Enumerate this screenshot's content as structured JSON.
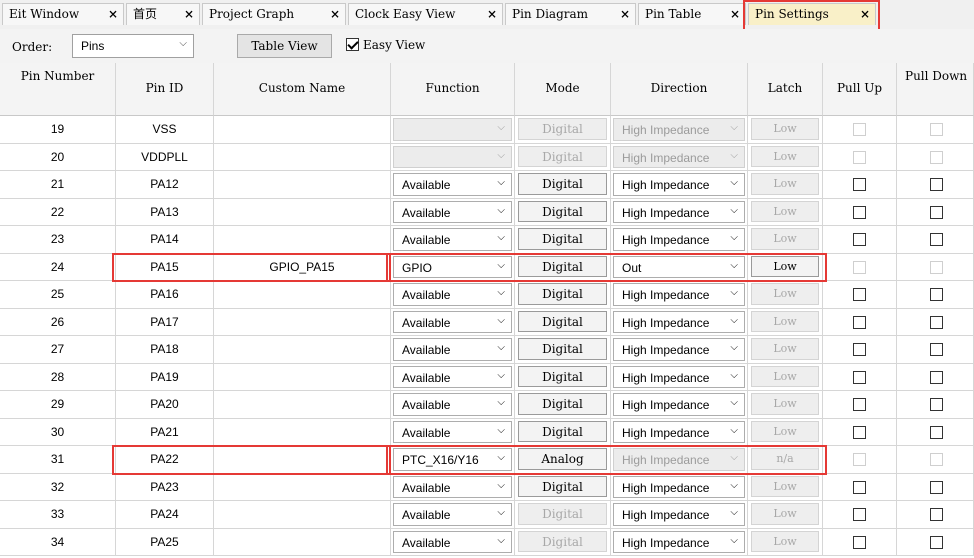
{
  "tabs": [
    {
      "label": "Eit Window",
      "closable": true
    },
    {
      "label": "首页",
      "closable": true
    },
    {
      "label": "Project Graph",
      "closable": true
    },
    {
      "label": "Clock Easy View",
      "closable": true
    },
    {
      "label": "Pin Diagram",
      "closable": true
    },
    {
      "label": "Pin Table",
      "closable": true
    },
    {
      "label": "Pin Settings",
      "closable": true,
      "active": true
    }
  ],
  "tab_close_glyph": "×",
  "toolbar": {
    "order_label": "Order:",
    "order_value": "Pins",
    "table_view_label": "Table View",
    "easy_view_label": "Easy View",
    "easy_view_checked": true
  },
  "columns": [
    "Pin Number",
    "Pin ID",
    "Custom Name",
    "Function",
    "Mode",
    "Direction",
    "Latch",
    "Pull Up",
    "Pull Down"
  ],
  "chevron_glyph": "⌵",
  "rows": [
    {
      "num": "19",
      "id": "VSS",
      "name": "",
      "func": "",
      "func_off": true,
      "mode": "Digital",
      "mode_off": true,
      "dir": "High Impedance",
      "dir_off": true,
      "latch": "Low",
      "latch_off": true,
      "pu": "off",
      "pd": "off"
    },
    {
      "num": "20",
      "id": "VDDPLL",
      "name": "",
      "func": "",
      "func_off": true,
      "mode": "Digital",
      "mode_off": true,
      "dir": "High Impedance",
      "dir_off": true,
      "latch": "Low",
      "latch_off": true,
      "pu": "off",
      "pd": "off"
    },
    {
      "num": "21",
      "id": "PA12",
      "name": "",
      "func": "Available",
      "mode": "Digital",
      "dir": "High Impedance",
      "latch": "Low",
      "latch_off": true,
      "pu": "on",
      "pd": "on"
    },
    {
      "num": "22",
      "id": "PA13",
      "name": "",
      "func": "Available",
      "mode": "Digital",
      "dir": "High Impedance",
      "latch": "Low",
      "latch_off": true,
      "pu": "on",
      "pd": "on"
    },
    {
      "num": "23",
      "id": "PA14",
      "name": "",
      "func": "Available",
      "mode": "Digital",
      "dir": "High Impedance",
      "latch": "Low",
      "latch_off": true,
      "pu": "on",
      "pd": "on"
    },
    {
      "num": "24",
      "id": "PA15",
      "name": "GPIO_PA15",
      "func": "GPIO",
      "mode": "Digital",
      "dir": "Out",
      "latch": "Low",
      "pu": "off",
      "pd": "off"
    },
    {
      "num": "25",
      "id": "PA16",
      "name": "",
      "func": "Available",
      "mode": "Digital",
      "dir": "High Impedance",
      "latch": "Low",
      "latch_off": true,
      "pu": "on",
      "pd": "on"
    },
    {
      "num": "26",
      "id": "PA17",
      "name": "",
      "func": "Available",
      "mode": "Digital",
      "dir": "High Impedance",
      "latch": "Low",
      "latch_off": true,
      "pu": "on",
      "pd": "on"
    },
    {
      "num": "27",
      "id": "PA18",
      "name": "",
      "func": "Available",
      "mode": "Digital",
      "dir": "High Impedance",
      "latch": "Low",
      "latch_off": true,
      "pu": "on",
      "pd": "on"
    },
    {
      "num": "28",
      "id": "PA19",
      "name": "",
      "func": "Available",
      "mode": "Digital",
      "dir": "High Impedance",
      "latch": "Low",
      "latch_off": true,
      "pu": "on",
      "pd": "on"
    },
    {
      "num": "29",
      "id": "PA20",
      "name": "",
      "func": "Available",
      "mode": "Digital",
      "dir": "High Impedance",
      "latch": "Low",
      "latch_off": true,
      "pu": "on",
      "pd": "on"
    },
    {
      "num": "30",
      "id": "PA21",
      "name": "",
      "func": "Available",
      "mode": "Digital",
      "dir": "High Impedance",
      "latch": "Low",
      "latch_off": true,
      "pu": "on",
      "pd": "on"
    },
    {
      "num": "31",
      "id": "PA22",
      "name": "",
      "func": "PTC_X16/Y16",
      "mode": "Analog",
      "dir": "High Impedance",
      "dir_off": true,
      "latch": "n/a",
      "latch_off": true,
      "pu": "off",
      "pd": "off"
    },
    {
      "num": "32",
      "id": "PA23",
      "name": "",
      "func": "Available",
      "mode": "Digital",
      "dir": "High Impedance",
      "latch": "Low",
      "latch_off": true,
      "pu": "on",
      "pd": "on"
    },
    {
      "num": "33",
      "id": "PA24",
      "name": "",
      "func": "Available",
      "mode": "Digital",
      "mode_off": true,
      "dir": "High Impedance",
      "latch": "Low",
      "latch_off": true,
      "pu": "on",
      "pd": "on"
    },
    {
      "num": "34",
      "id": "PA25",
      "name": "",
      "func": "Available",
      "mode": "Digital",
      "mode_off": true,
      "dir": "High Impedance",
      "latch": "Low",
      "latch_off": true,
      "pu": "on",
      "pd": "on"
    }
  ],
  "highlight_color": "#e53935"
}
